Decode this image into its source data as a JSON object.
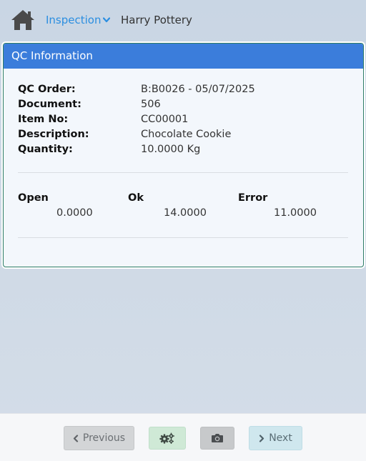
{
  "header": {
    "home_icon": "home-icon",
    "nav_label": "Inspection",
    "user_name": "Harry Pottery"
  },
  "card": {
    "title": "QC Information",
    "fields": [
      {
        "label": "QC Order:",
        "value": "B:B0026 - 05/07/2025"
      },
      {
        "label": "Document:",
        "value": "506"
      },
      {
        "label": "Item No:",
        "value": "CC00001"
      },
      {
        "label": "Description:",
        "value": "Chocolate Cookie"
      },
      {
        "label": "Quantity:",
        "value": "10.0000 Kg"
      }
    ],
    "stats": [
      {
        "label": "Open",
        "value": "0.0000"
      },
      {
        "label": "Ok",
        "value": "14.0000"
      },
      {
        "label": "Error",
        "value": "11.0000"
      }
    ]
  },
  "footer": {
    "previous_label": "Previous",
    "next_label": "Next",
    "gear_icon": "gears-icon",
    "camera_icon": "camera-icon"
  },
  "colors": {
    "accent": "#3b7ddb",
    "link": "#2b8ee0",
    "card_border": "#2e7d67"
  }
}
